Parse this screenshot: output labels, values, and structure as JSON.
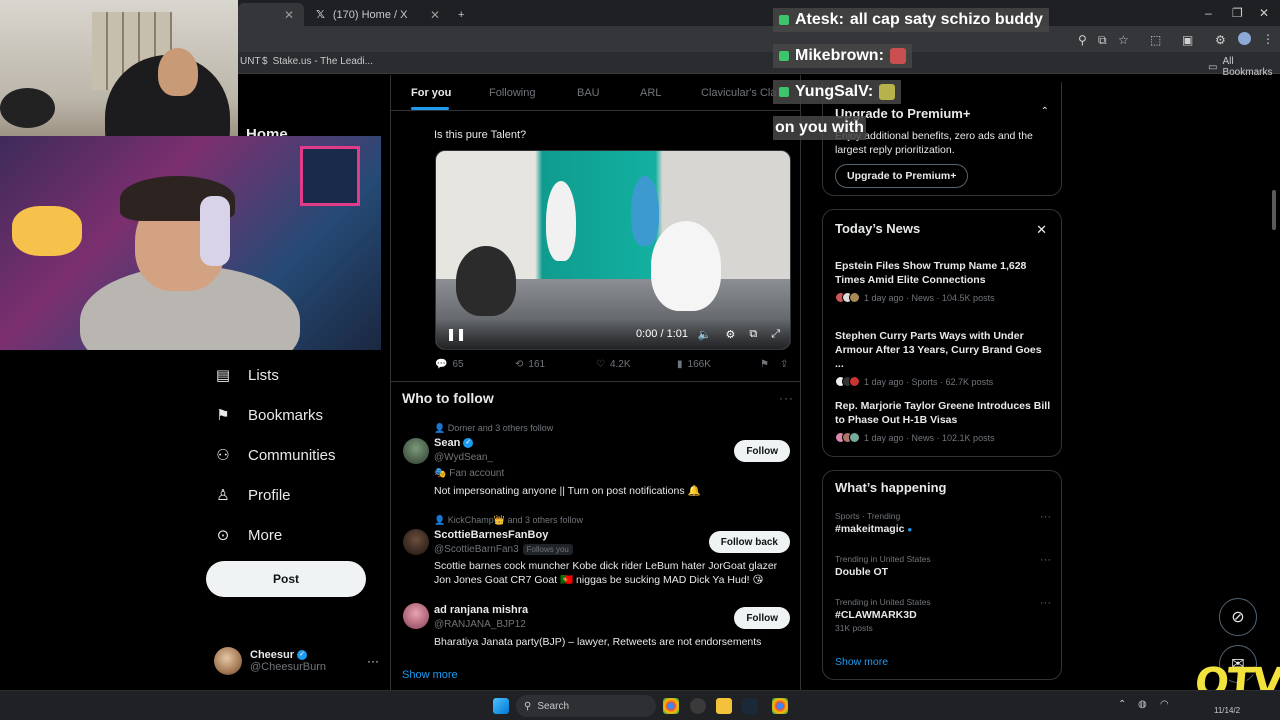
{
  "browser": {
    "tabs": [
      {
        "title": "",
        "active": true
      },
      {
        "title": "(170) Home / X",
        "active": false
      }
    ],
    "new_tab": "+",
    "window_controls": [
      "–",
      "❐",
      "✕"
    ],
    "bookmarks": [
      {
        "label": "UNT"
      },
      {
        "label": "Stake.us - The Leadi..."
      }
    ],
    "all_bookmarks": "All Bookmarks"
  },
  "nav": {
    "partial_home": "Home",
    "items": [
      {
        "label": "Lists",
        "icon": "list-icon"
      },
      {
        "label": "Bookmarks",
        "icon": "bookmark-icon"
      },
      {
        "label": "Communities",
        "icon": "communities-icon"
      },
      {
        "label": "Profile",
        "icon": "profile-icon"
      },
      {
        "label": "More",
        "icon": "more-circle-icon"
      }
    ],
    "post_label": "Post"
  },
  "account": {
    "name": "Cheesur",
    "handle": "@CheesurBurn",
    "menu": "···"
  },
  "timeline": {
    "tabs": [
      "For you",
      "Following",
      "BAU",
      "ARL",
      "Clavicular's Cla"
    ],
    "tweet": {
      "text": "Is this pure Talent?",
      "video_time": "0:00 / 1:01",
      "replies": "65",
      "reposts": "161",
      "likes": "4.2K",
      "views": "166K"
    },
    "who_to_follow": {
      "title": "Who to follow",
      "users": [
        {
          "social": "Dorner and 3 others follow",
          "name": "Sean",
          "handle": "@WydSean_",
          "tag": "Fan account",
          "bio": "Not impersonating anyone || Turn on post notifications 🔔",
          "button": "Follow",
          "verified": true
        },
        {
          "social": "KickChamp👑 and 3 others follow",
          "name": "ScottieBarnesFanBoy",
          "handle": "@ScottieBarnFan3",
          "follows_you": "Follows you",
          "bio": "Scottie barnes cock muncher Kobe dick rider LeBum hater JorGoat glazer Jon Jones Goat CR7 Goat 🇵🇹 niggas be sucking MAD Dick Ya Hud! 😘",
          "button": "Follow back",
          "verified": false
        },
        {
          "social": "",
          "name": "ad ranjana mishra",
          "handle": "@RANJANA_BJP12",
          "bio": "Bharatiya Janata party(BJP) – lawyer, Retweets are not endorsements",
          "button": "Follow",
          "verified": false
        }
      ],
      "show_more": "Show more"
    }
  },
  "right": {
    "premium": {
      "title": "Upgrade to Premium+",
      "desc": "Enjoy additional benefits, zero ads and the largest reply prioritization.",
      "button": "Upgrade to Premium+"
    },
    "news": {
      "title": "Today’s News",
      "items": [
        {
          "headline": "Epstein Files Show Trump Name 1,628 Times Amid Elite Connections",
          "meta": "1 day ago · News · 104.5K posts"
        },
        {
          "headline": "Stephen Curry Parts Ways with Under Armour After 13 Years, Curry Brand Goes ...",
          "meta": "1 day ago · Sports · 62.7K posts"
        },
        {
          "headline": "Rep. Marjorie Taylor Greene Introduces Bill to Phase Out H-1B Visas",
          "meta": "1 day ago · News · 102.1K posts"
        }
      ]
    },
    "happening": {
      "title": "What’s happening",
      "trends": [
        {
          "context": "Sports · Trending",
          "name": "#makeitmagic",
          "count": ""
        },
        {
          "context": "Trending in United States",
          "name": "Double OT",
          "count": ""
        },
        {
          "context": "Trending in United States",
          "name": "#CLAWMARK3D",
          "count": "31K posts"
        }
      ],
      "show_more": "Show more"
    }
  },
  "chat": [
    {
      "user": "Atesk:",
      "msg": "all cap saty schizo buddy"
    },
    {
      "user": "Mikebrown:",
      "msg": ""
    },
    {
      "user": "YungSalV:",
      "msg": ""
    },
    {
      "user": "",
      "msg": "on you with"
    }
  ],
  "taskbar": {
    "search": "Search",
    "clock": "11/14/2"
  },
  "overlay_logo": "OTV",
  "colors": {
    "accent": "#1d9bf0",
    "background": "#000000",
    "border": "#2f3336",
    "muted": "#71767b"
  }
}
